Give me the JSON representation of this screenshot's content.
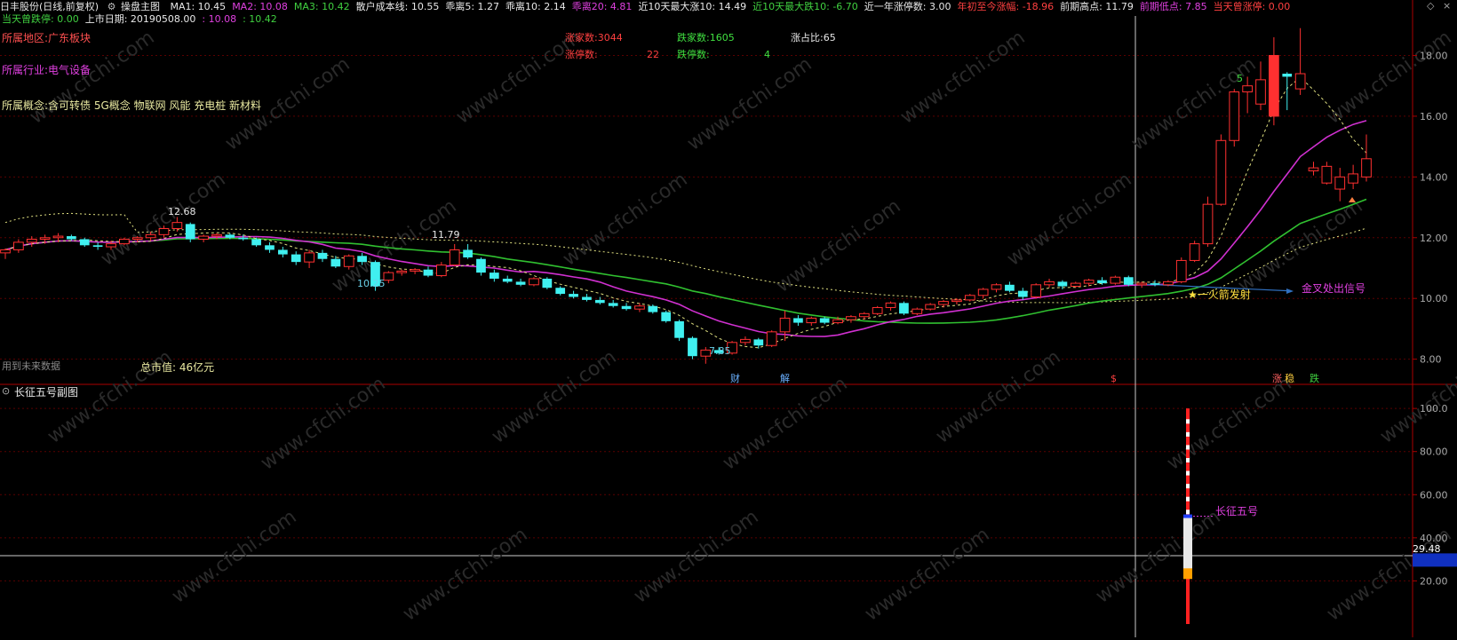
{
  "header": {
    "stock_name": "日丰股份(日线,前复权)",
    "chart_title": "操盘主图",
    "items": [
      {
        "text": "MA1: 10.45",
        "color": "#e8e8e8"
      },
      {
        "text": "MA2: 10.08",
        "color": "#e040e0"
      },
      {
        "text": "MA3: 10.42",
        "color": "#40d040"
      },
      {
        "text": "散户成本线: 10.55",
        "color": "#e8e8e8"
      },
      {
        "text": "乖离5: 1.27",
        "color": "#e8e8e8"
      },
      {
        "text": "乖离10: 2.14",
        "color": "#e8e8e8"
      },
      {
        "text": "乖离20: 4.81",
        "color": "#e040e0"
      },
      {
        "text": "近10天最大涨10: 14.49",
        "color": "#e8e8e8"
      },
      {
        "text": "近10天最大跌10: -6.70",
        "color": "#40d040"
      },
      {
        "text": "近一年涨停数: 3.00",
        "color": "#e8e8e8"
      },
      {
        "text": "年初至今涨幅: -18.96",
        "color": "#ff4040"
      },
      {
        "text": "前期高点: 11.79",
        "color": "#e8e8e8"
      },
      {
        "text": "前期低点: 7.85",
        "color": "#e040e0"
      },
      {
        "text": "当天曾涨停: 0.00",
        "color": "#ff4040"
      }
    ],
    "line2": [
      {
        "text": "当天曾跌停: 0.00",
        "color": "#40d040"
      },
      {
        "text": "上市日期: 20190508.00",
        "color": "#e8e8e8"
      },
      {
        "text": ": 10.08",
        "color": "#e040e0"
      },
      {
        "text": ": 10.42",
        "color": "#40d040"
      }
    ]
  },
  "info": {
    "region": "所属地区:广东板块",
    "industry": "所属行业:电气设备",
    "concepts": "所属概念:含可转债 5G概念 物联网 风能 充电桩 新材料",
    "market_cap": "总市值: 46亿元",
    "future_data": "用到未来数据"
  },
  "breadth": {
    "up_count": "涨家数:3044",
    "down_count": "跌家数:1605",
    "up_ratio": "涨占比:65",
    "limit_up_label": "涨停数:",
    "limit_up_value": "22",
    "limit_down_label": "跌停数:",
    "limit_down_value": "4"
  },
  "annotations": {
    "high_label": "12.68",
    "mid_label": "11.79",
    "low1_label": "10.25",
    "low2_label": "7.85",
    "count_label": "5",
    "rocket": "★一火箭发射",
    "golden_cross": "金叉处出信号",
    "markers": [
      {
        "text": "财",
        "color": "#6ab0ff"
      },
      {
        "text": "解",
        "color": "#6ab0ff"
      },
      {
        "text": "$",
        "color": "#ff4040"
      },
      {
        "text": "涨",
        "color": "#ff6060"
      },
      {
        "text": "稳",
        "color": "#ffd040"
      },
      {
        "text": "跌",
        "color": "#40d040"
      }
    ]
  },
  "axis_main": [
    "18.00",
    "16.00",
    "14.00",
    "12.00",
    "10.00",
    "8.00"
  ],
  "sub": {
    "title": "长征五号副图",
    "label": "长征五号",
    "axis": [
      "100.0",
      "80.00",
      "60.00",
      "40.00",
      "20.00"
    ],
    "cursor_value": "29.48"
  },
  "watermark": "www.cfchi.com",
  "colors": {
    "up": "#ff3030",
    "down": "#40f0f0",
    "ma1": "#e0e080",
    "ma2": "#d030d0",
    "ma3": "#30c030",
    "grid": "#5a0000",
    "axis": "#aa0000"
  },
  "chart_data": {
    "type": "candlestick",
    "price_axis": {
      "ylim": [
        7.2,
        19.3
      ],
      "ticks": [
        8,
        10,
        12,
        14,
        16,
        18
      ]
    },
    "candles": [
      [
        11.5,
        11.65,
        11.3,
        11.6
      ],
      [
        11.6,
        11.95,
        11.5,
        11.85
      ],
      [
        11.85,
        12.05,
        11.7,
        11.95
      ],
      [
        11.95,
        12.1,
        11.8,
        12.0
      ],
      [
        12.0,
        12.15,
        11.85,
        12.05
      ],
      [
        12.05,
        12.1,
        11.9,
        11.95
      ],
      [
        11.95,
        12.0,
        11.7,
        11.75
      ],
      [
        11.75,
        11.85,
        11.6,
        11.7
      ],
      [
        11.7,
        11.9,
        11.6,
        11.8
      ],
      [
        11.8,
        12.0,
        11.75,
        11.95
      ],
      [
        11.95,
        12.05,
        11.85,
        12.0
      ],
      [
        12.0,
        12.2,
        11.9,
        12.1
      ],
      [
        12.1,
        12.4,
        12.0,
        12.3
      ],
      [
        12.3,
        12.68,
        12.2,
        12.5
      ],
      [
        12.45,
        12.5,
        11.85,
        11.95
      ],
      [
        11.95,
        12.1,
        11.85,
        12.05
      ],
      [
        12.05,
        12.15,
        11.95,
        12.1
      ],
      [
        12.1,
        12.15,
        11.95,
        12.0
      ],
      [
        12.0,
        12.1,
        11.9,
        11.95
      ],
      [
        11.95,
        12.0,
        11.7,
        11.75
      ],
      [
        11.75,
        11.85,
        11.5,
        11.6
      ],
      [
        11.6,
        11.7,
        11.35,
        11.45
      ],
      [
        11.45,
        11.55,
        11.1,
        11.2
      ],
      [
        11.2,
        11.6,
        11.0,
        11.5
      ],
      [
        11.5,
        11.6,
        11.2,
        11.3
      ],
      [
        11.3,
        11.4,
        11.0,
        11.05
      ],
      [
        11.05,
        11.45,
        10.95,
        11.4
      ],
      [
        11.4,
        11.5,
        11.1,
        11.2
      ],
      [
        11.2,
        11.25,
        10.25,
        10.4
      ],
      [
        10.6,
        10.9,
        10.5,
        10.85
      ],
      [
        10.85,
        10.95,
        10.75,
        10.9
      ],
      [
        10.9,
        11.0,
        10.8,
        10.95
      ],
      [
        10.95,
        11.05,
        10.7,
        10.75
      ],
      [
        10.75,
        11.2,
        10.7,
        11.1
      ],
      [
        11.1,
        11.79,
        11.05,
        11.6
      ],
      [
        11.6,
        11.79,
        11.3,
        11.35
      ],
      [
        11.3,
        11.35,
        10.75,
        10.85
      ],
      [
        10.85,
        10.95,
        10.55,
        10.65
      ],
      [
        10.65,
        10.75,
        10.5,
        10.55
      ],
      [
        10.55,
        10.65,
        10.4,
        10.45
      ],
      [
        10.45,
        10.7,
        10.4,
        10.65
      ],
      [
        10.65,
        10.7,
        10.3,
        10.35
      ],
      [
        10.35,
        10.4,
        10.1,
        10.15
      ],
      [
        10.15,
        10.25,
        10.0,
        10.05
      ],
      [
        10.05,
        10.15,
        9.9,
        9.95
      ],
      [
        9.95,
        10.05,
        9.8,
        9.85
      ],
      [
        9.85,
        9.95,
        9.7,
        9.75
      ],
      [
        9.75,
        9.85,
        9.6,
        9.65
      ],
      [
        9.65,
        9.85,
        9.55,
        9.75
      ],
      [
        9.75,
        9.8,
        9.5,
        9.55
      ],
      [
        9.55,
        9.6,
        9.2,
        9.25
      ],
      [
        9.25,
        9.3,
        8.6,
        8.7
      ],
      [
        8.7,
        8.75,
        8.0,
        8.1
      ],
      [
        8.1,
        8.4,
        7.85,
        8.3
      ],
      [
        8.3,
        8.4,
        8.15,
        8.2
      ],
      [
        8.2,
        8.6,
        8.15,
        8.55
      ],
      [
        8.55,
        8.75,
        8.45,
        8.65
      ],
      [
        8.65,
        8.7,
        8.35,
        8.45
      ],
      [
        8.45,
        8.95,
        8.4,
        8.9
      ],
      [
        8.9,
        9.6,
        8.6,
        9.35
      ],
      [
        9.35,
        9.45,
        9.1,
        9.2
      ],
      [
        9.2,
        9.4,
        9.1,
        9.35
      ],
      [
        9.35,
        9.4,
        9.15,
        9.2
      ],
      [
        9.2,
        9.4,
        9.15,
        9.3
      ],
      [
        9.3,
        9.45,
        9.2,
        9.4
      ],
      [
        9.4,
        9.55,
        9.3,
        9.5
      ],
      [
        9.5,
        9.75,
        9.45,
        9.7
      ],
      [
        9.7,
        9.9,
        9.6,
        9.85
      ],
      [
        9.85,
        9.9,
        9.45,
        9.5
      ],
      [
        9.5,
        9.7,
        9.45,
        9.65
      ],
      [
        9.65,
        9.85,
        9.6,
        9.8
      ],
      [
        9.8,
        9.95,
        9.7,
        9.9
      ],
      [
        9.9,
        10.0,
        9.8,
        9.95
      ],
      [
        9.95,
        10.15,
        9.9,
        10.1
      ],
      [
        10.1,
        10.35,
        10.0,
        10.3
      ],
      [
        10.3,
        10.5,
        10.2,
        10.45
      ],
      [
        10.45,
        10.55,
        10.2,
        10.25
      ],
      [
        10.25,
        10.35,
        9.95,
        10.05
      ],
      [
        10.05,
        10.5,
        10.0,
        10.45
      ],
      [
        10.45,
        10.65,
        10.35,
        10.55
      ],
      [
        10.55,
        10.6,
        10.3,
        10.4
      ],
      [
        10.4,
        10.55,
        10.35,
        10.5
      ],
      [
        10.5,
        10.65,
        10.4,
        10.6
      ],
      [
        10.6,
        10.7,
        10.45,
        10.5
      ],
      [
        10.5,
        10.75,
        10.45,
        10.7
      ],
      [
        10.7,
        10.75,
        10.4,
        10.45
      ],
      [
        10.45,
        10.55,
        10.35,
        10.5
      ],
      [
        10.5,
        10.6,
        10.4,
        10.45
      ],
      [
        10.45,
        10.6,
        10.4,
        10.55
      ],
      [
        10.55,
        11.35,
        10.5,
        11.25
      ],
      [
        11.25,
        11.9,
        11.2,
        11.8
      ],
      [
        11.8,
        13.35,
        11.7,
        13.1
      ],
      [
        13.1,
        15.4,
        13.05,
        15.2
      ],
      [
        15.2,
        16.9,
        15.0,
        16.8
      ],
      [
        16.8,
        17.3,
        16.1,
        17.0
      ],
      [
        16.4,
        17.8,
        16.2,
        17.2
      ],
      [
        16.0,
        18.6,
        15.7,
        18.0
      ],
      [
        17.4,
        17.45,
        16.2,
        17.3
      ],
      [
        16.9,
        18.9,
        16.7,
        17.4
      ],
      [
        14.2,
        14.5,
        14.05,
        14.3
      ],
      [
        13.8,
        14.5,
        13.75,
        14.35
      ],
      [
        13.6,
        14.3,
        13.2,
        14.0
      ],
      [
        13.8,
        14.4,
        13.6,
        14.1
      ],
      [
        14.0,
        15.4,
        13.85,
        14.6
      ]
    ],
    "sub_axis": {
      "ylim": [
        0,
        105
      ],
      "ticks": [
        20,
        40,
        60,
        80,
        100
      ]
    },
    "sub_series": {
      "name": "长征五号",
      "cursor": 29.48,
      "rocket_top": 100,
      "rocket_bottom": 0,
      "white_segment": [
        25,
        50
      ],
      "blue_marker": 50
    }
  }
}
